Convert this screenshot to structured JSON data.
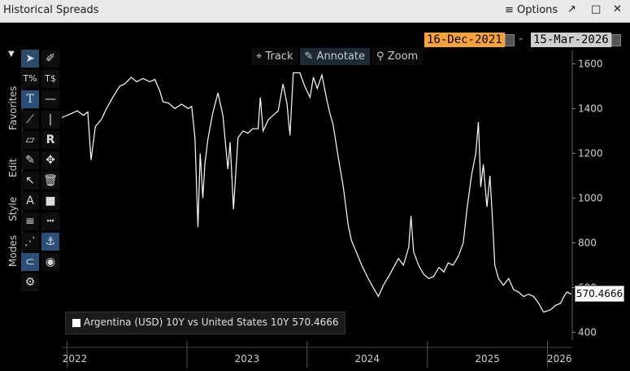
{
  "window": {
    "title": "Historical Spreads",
    "options_label": "Options",
    "menu_icon": "hamburger-icon",
    "icons": [
      "pin-icon",
      "maximize-icon",
      "close-icon"
    ]
  },
  "date_range": {
    "start": "16-Dec-2021",
    "separator": "-",
    "end": "15-Mar-2026"
  },
  "top_tools": [
    {
      "icon": "crosshair-icon",
      "label": "Track"
    },
    {
      "icon": "pencil-icon",
      "label": "Annotate"
    },
    {
      "icon": "magnifier-icon",
      "label": "Zoom"
    }
  ],
  "side_tabs": [
    "Favorites",
    "Edit",
    "Style",
    "Modes"
  ],
  "legend": {
    "label": "Argentina (USD) 10Y vs United States 10Y 570.4666",
    "color": "#ffffff"
  },
  "last_value_label": "570.4666",
  "chart_data": {
    "type": "line",
    "y_ticks": [
      400,
      600,
      800,
      1000,
      1200,
      1400,
      1600
    ],
    "ylim": [
      365,
      1660
    ],
    "x_ticks": [
      "2022",
      "2023",
      "2024",
      "2025",
      "2026"
    ],
    "xlim": [
      "2021-12-16",
      "2026-03-15"
    ],
    "grid": false,
    "series": [
      {
        "name": "Argentina (USD) 10Y vs United States 10Y",
        "color": "#ffffff",
        "points": [
          [
            "2021-12-16",
            1360
          ],
          [
            "2022-01-10",
            1375
          ],
          [
            "2022-02-01",
            1390
          ],
          [
            "2022-02-20",
            1370
          ],
          [
            "2022-03-05",
            1385
          ],
          [
            "2022-03-15",
            1170
          ],
          [
            "2022-03-28",
            1320
          ],
          [
            "2022-04-15",
            1350
          ],
          [
            "2022-05-01",
            1400
          ],
          [
            "2022-05-20",
            1450
          ],
          [
            "2022-06-10",
            1500
          ],
          [
            "2022-06-25",
            1510
          ],
          [
            "2022-07-15",
            1540
          ],
          [
            "2022-08-01",
            1520
          ],
          [
            "2022-08-20",
            1535
          ],
          [
            "2022-09-10",
            1520
          ],
          [
            "2022-09-25",
            1530
          ],
          [
            "2022-10-10",
            1480
          ],
          [
            "2022-10-20",
            1430
          ],
          [
            "2022-11-05",
            1425
          ],
          [
            "2022-11-25",
            1400
          ],
          [
            "2022-12-15",
            1420
          ],
          [
            "2023-01-05",
            1400
          ],
          [
            "2023-01-15",
            1410
          ],
          [
            "2023-01-25",
            1270
          ],
          [
            "2023-02-03",
            870
          ],
          [
            "2023-02-10",
            1200
          ],
          [
            "2023-02-18",
            1000
          ],
          [
            "2023-02-24",
            1150
          ],
          [
            "2023-03-05",
            1260
          ],
          [
            "2023-03-20",
            1380
          ],
          [
            "2023-04-05",
            1470
          ],
          [
            "2023-04-20",
            1370
          ],
          [
            "2023-05-05",
            1130
          ],
          [
            "2023-05-12",
            1250
          ],
          [
            "2023-05-22",
            950
          ],
          [
            "2023-06-05",
            1270
          ],
          [
            "2023-06-20",
            1300
          ],
          [
            "2023-07-05",
            1290
          ],
          [
            "2023-07-20",
            1310
          ],
          [
            "2023-08-05",
            1310
          ],
          [
            "2023-08-12",
            1450
          ],
          [
            "2023-08-20",
            1300
          ],
          [
            "2023-09-05",
            1350
          ],
          [
            "2023-09-20",
            1370
          ],
          [
            "2023-10-05",
            1390
          ],
          [
            "2023-10-20",
            1510
          ],
          [
            "2023-11-01",
            1420
          ],
          [
            "2023-11-10",
            1280
          ],
          [
            "2023-11-20",
            1560
          ],
          [
            "2023-12-10",
            1560
          ],
          [
            "2023-12-25",
            1500
          ],
          [
            "2024-01-10",
            1450
          ],
          [
            "2024-01-20",
            1540
          ],
          [
            "2024-02-01",
            1490
          ],
          [
            "2024-02-15",
            1550
          ],
          [
            "2024-03-01",
            1440
          ],
          [
            "2024-03-10",
            1380
          ],
          [
            "2024-03-20",
            1330
          ],
          [
            "2024-04-05",
            1180
          ],
          [
            "2024-04-20",
            1050
          ],
          [
            "2024-05-05",
            880
          ],
          [
            "2024-05-15",
            810
          ],
          [
            "2024-06-01",
            750
          ],
          [
            "2024-06-15",
            700
          ],
          [
            "2024-07-05",
            640
          ],
          [
            "2024-07-20",
            600
          ],
          [
            "2024-08-05",
            560
          ],
          [
            "2024-08-20",
            610
          ],
          [
            "2024-09-05",
            650
          ],
          [
            "2024-09-20",
            690
          ],
          [
            "2024-10-05",
            730
          ],
          [
            "2024-10-20",
            700
          ],
          [
            "2024-11-05",
            780
          ],
          [
            "2024-11-12",
            920
          ],
          [
            "2024-11-20",
            760
          ],
          [
            "2024-12-05",
            700
          ],
          [
            "2024-12-20",
            660
          ],
          [
            "2025-01-05",
            640
          ],
          [
            "2025-01-20",
            650
          ],
          [
            "2025-02-05",
            690
          ],
          [
            "2025-02-20",
            670
          ],
          [
            "2025-03-05",
            710
          ],
          [
            "2025-03-20",
            700
          ],
          [
            "2025-04-05",
            740
          ],
          [
            "2025-04-20",
            800
          ],
          [
            "2025-05-01",
            950
          ],
          [
            "2025-05-15",
            1100
          ],
          [
            "2025-05-28",
            1200
          ],
          [
            "2025-06-05",
            1340
          ],
          [
            "2025-06-12",
            1050
          ],
          [
            "2025-06-20",
            1150
          ],
          [
            "2025-07-01",
            960
          ],
          [
            "2025-07-10",
            1100
          ],
          [
            "2025-07-18",
            900
          ],
          [
            "2025-07-25",
            700
          ],
          [
            "2025-08-05",
            640
          ],
          [
            "2025-08-20",
            610
          ],
          [
            "2025-09-05",
            640
          ],
          [
            "2025-09-20",
            590
          ],
          [
            "2025-10-05",
            580
          ],
          [
            "2025-10-20",
            560
          ],
          [
            "2025-11-05",
            570
          ],
          [
            "2025-11-20",
            560
          ],
          [
            "2025-12-05",
            530
          ],
          [
            "2025-12-20",
            490
          ],
          [
            "2026-01-10",
            500
          ],
          [
            "2026-01-25",
            520
          ],
          [
            "2026-02-10",
            530
          ],
          [
            "2026-02-20",
            560
          ],
          [
            "2026-03-01",
            580
          ],
          [
            "2026-03-15",
            570
          ]
        ]
      }
    ]
  }
}
